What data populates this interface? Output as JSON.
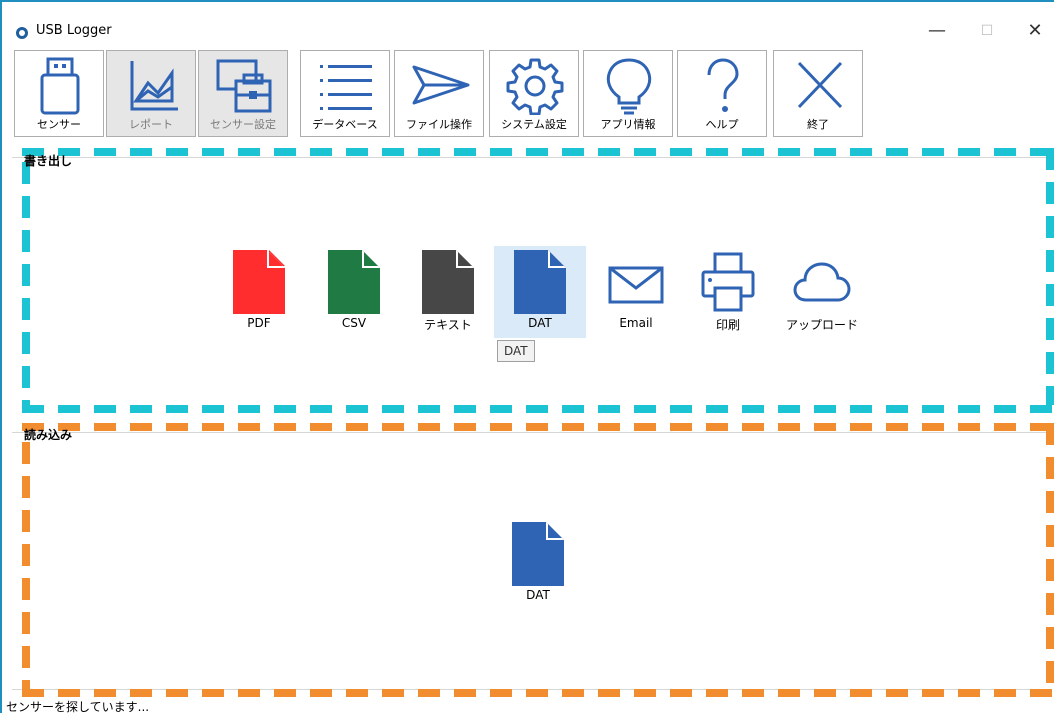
{
  "window": {
    "title": "USB Logger",
    "minimize_glyph": "—",
    "maximize_glyph": "☐",
    "close_glyph": "✕"
  },
  "toolbar": [
    {
      "label": "センサー",
      "icon": "usb-drive-icon",
      "enabled": true
    },
    {
      "label": "レポート",
      "icon": "chart-icon",
      "enabled": false
    },
    {
      "label": "センサー設定",
      "icon": "sensor-settings-icon",
      "enabled": false
    },
    {
      "label": "データベース",
      "icon": "list-icon",
      "enabled": true
    },
    {
      "label": "ファイル操作",
      "icon": "send-icon",
      "enabled": true
    },
    {
      "label": "システム設定",
      "icon": "gear-icon",
      "enabled": true
    },
    {
      "label": "アプリ情報",
      "icon": "lightbulb-icon",
      "enabled": true
    },
    {
      "label": "ヘルプ",
      "icon": "question-icon",
      "enabled": true
    },
    {
      "label": "終了",
      "icon": "close-icon",
      "enabled": true
    }
  ],
  "export": {
    "title": "書き出し",
    "items": [
      {
        "label": "PDF",
        "icon": "pdf-file-icon",
        "color": "#ff2d2d"
      },
      {
        "label": "CSV",
        "icon": "csv-file-icon",
        "color": "#1f7a44"
      },
      {
        "label": "テキスト",
        "icon": "text-file-icon",
        "color": "#474747"
      },
      {
        "label": "DAT",
        "icon": "dat-file-icon",
        "color": "#2f63b4",
        "selected": true
      },
      {
        "label": "Email",
        "icon": "email-icon",
        "color": "#2f63b4"
      },
      {
        "label": "印刷",
        "icon": "printer-icon",
        "color": "#2f63b4"
      },
      {
        "label": "アップロード",
        "icon": "cloud-icon",
        "color": "#2f63b4"
      }
    ],
    "tooltip": "DAT"
  },
  "import": {
    "title": "読み込み",
    "items": [
      {
        "label": "DAT",
        "icon": "dat-file-icon",
        "color": "#2f63b4"
      }
    ]
  },
  "status": "センサーを探しています...",
  "colors": {
    "accent": "#2f63b4",
    "highlight_export": "#1cc3d3",
    "highlight_import": "#f18c2f"
  }
}
